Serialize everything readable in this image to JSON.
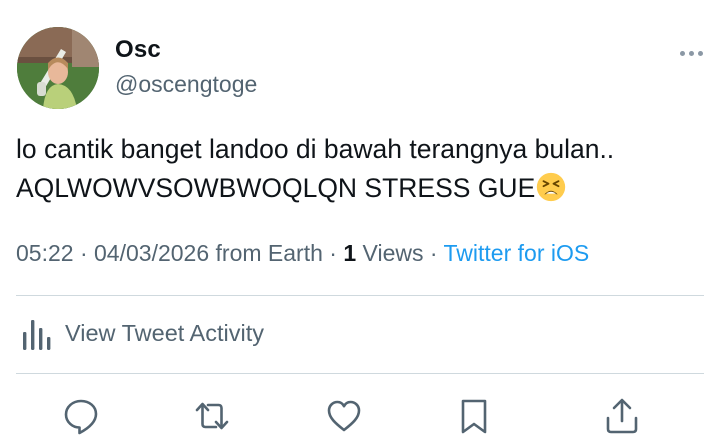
{
  "user": {
    "display_name": "Osc",
    "handle": "@oscengtoge",
    "avatar_icon": "profile-photo"
  },
  "tweet": {
    "lines": [
      "lo cantik banget landoo di bawah terangnya bulan..",
      "AQLWOWVSOWBWOQLQN STRESS GUE"
    ],
    "emoji": "tired-face-emoji"
  },
  "meta": {
    "time": "05:22",
    "sep1": " · ",
    "date": "04/03/2026",
    "location": " from Earth",
    "sep2": " · ",
    "views_count": "1",
    "views_label": " Views",
    "sep3": " · ",
    "source": "Twitter for iOS"
  },
  "activity": {
    "label": "View Tweet Activity",
    "icon": "bar-chart-icon"
  },
  "actions": [
    {
      "name": "reply",
      "icon": "reply-icon"
    },
    {
      "name": "retweet",
      "icon": "retweet-icon"
    },
    {
      "name": "like",
      "icon": "heart-icon"
    },
    {
      "name": "bookmark",
      "icon": "bookmark-icon"
    },
    {
      "name": "share",
      "icon": "share-icon"
    }
  ],
  "colors": {
    "text": "#0f1419",
    "secondary": "#536471",
    "link": "#1d9bf0",
    "divider": "#cfd9de",
    "icon": "#536471"
  }
}
